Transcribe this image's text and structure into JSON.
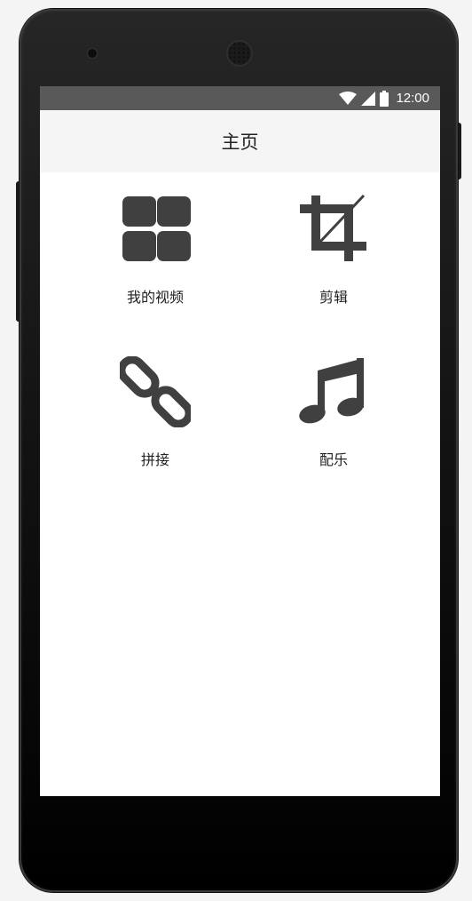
{
  "status_bar": {
    "time": "12:00",
    "icons": [
      "wifi-icon",
      "cell-signal-icon",
      "battery-icon"
    ]
  },
  "header": {
    "title": "主页"
  },
  "grid": {
    "items": [
      {
        "label": "我的视频",
        "icon": "grid-icon"
      },
      {
        "label": "剪辑",
        "icon": "crop-icon"
      },
      {
        "label": "拼接",
        "icon": "link-icon"
      },
      {
        "label": "配乐",
        "icon": "music-note-icon"
      }
    ]
  },
  "colors": {
    "icon": "#404040",
    "status_bar": "#595959",
    "app_bar": "#f5f5f5",
    "phone_body": "#1c1c1c"
  }
}
